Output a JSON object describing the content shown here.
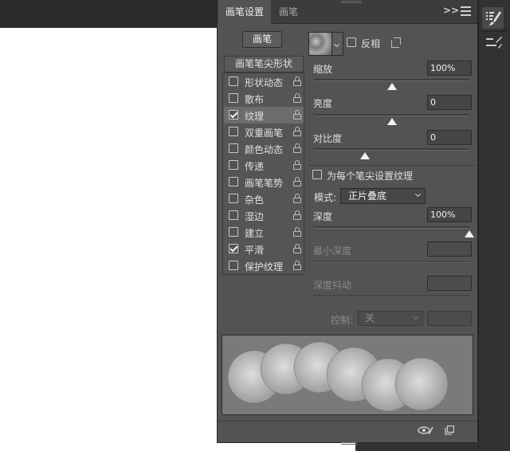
{
  "tabs": [
    {
      "label": "画笔设置",
      "active": true
    },
    {
      "label": "画笔",
      "active": false
    }
  ],
  "header": {
    "collapse_glyph": ">>"
  },
  "brushes_button_label": "画笔",
  "tip_shape_label": "画笔笔尖形状",
  "options": [
    {
      "label": "形状动态",
      "checked": false,
      "selected": false
    },
    {
      "label": "散布",
      "checked": false,
      "selected": false
    },
    {
      "label": "纹理",
      "checked": true,
      "selected": true
    },
    {
      "label": "双重画笔",
      "checked": false,
      "selected": false
    },
    {
      "label": "颜色动态",
      "checked": false,
      "selected": false
    },
    {
      "label": "传递",
      "checked": false,
      "selected": false
    },
    {
      "label": "画笔笔势",
      "checked": false,
      "selected": false
    },
    {
      "label": "杂色",
      "checked": false,
      "selected": false
    },
    {
      "label": "湿边",
      "checked": false,
      "selected": false
    },
    {
      "label": "建立",
      "checked": false,
      "selected": false
    },
    {
      "label": "平滑",
      "checked": true,
      "selected": false
    },
    {
      "label": "保护纹理",
      "checked": false,
      "selected": false
    }
  ],
  "texture": {
    "invert_label": "反相",
    "invert_checked": false,
    "scale_label": "缩放",
    "scale_value": "100%",
    "brightness_label": "亮度",
    "brightness_value": "0",
    "contrast_label": "对比度",
    "contrast_value": "0",
    "per_tip_label": "为每个笔尖设置纹理",
    "per_tip_checked": false,
    "mode_label": "模式:",
    "mode_value": "正片叠底",
    "depth_label": "深度",
    "depth_value": "100%",
    "min_depth_label": "最小深度",
    "depth_jitter_label": "深度抖动",
    "control_label": "控制:",
    "control_value": "关"
  },
  "slider_levels": {
    "scale": 0.5,
    "brightness": 0.5,
    "contrast": 0.33,
    "depth": 1.0
  },
  "colors": {
    "panel_bg": "#535353",
    "tab_bar": "#3c3c3c",
    "selected_row": "#6c6c6c",
    "field_bg": "#454545"
  }
}
